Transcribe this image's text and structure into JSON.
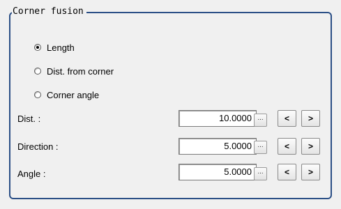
{
  "group": {
    "title": "Corner fusion"
  },
  "radios": [
    {
      "label": "Length",
      "checked": true
    },
    {
      "label": "Dist. from corner",
      "checked": false
    },
    {
      "label": "Corner angle",
      "checked": false
    }
  ],
  "fields": [
    {
      "label": "Dist. :",
      "value": "10.0000",
      "more": "...",
      "decrement": "<",
      "increment": ">"
    },
    {
      "label": "Direction :",
      "value": "5.0000",
      "more": "...",
      "decrement": "<",
      "increment": ">"
    },
    {
      "label": "Angle :",
      "value": "5.0000",
      "more": "...",
      "decrement": "<",
      "increment": ">"
    }
  ]
}
